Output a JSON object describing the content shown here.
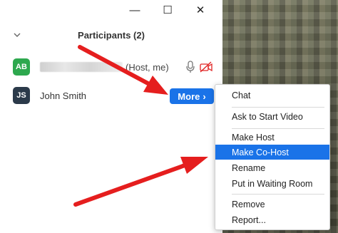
{
  "window": {
    "min_glyph": "—",
    "max_glyph": "☐",
    "close_glyph": "✕"
  },
  "panel": {
    "title": "Participants (2)"
  },
  "participants": [
    {
      "initials": "AB",
      "name": "",
      "role": "(Host, me)",
      "avatar_color": "#2da84e"
    },
    {
      "initials": "JS",
      "name": "John Smith",
      "avatar_color": "#2b3a4a"
    }
  ],
  "more_button": {
    "label": "More",
    "chevron": "›"
  },
  "menu": {
    "items": [
      {
        "label": "Chat"
      },
      {
        "label": "Ask to Start Video"
      },
      {
        "label": "Make Host"
      },
      {
        "label": "Make Co-Host",
        "highlighted": true
      },
      {
        "label": "Rename"
      },
      {
        "label": "Put in Waiting Room"
      },
      {
        "label": "Remove"
      },
      {
        "label": "Report..."
      }
    ]
  },
  "colors": {
    "accent": "#1a73e8",
    "arrow": "#e51e1e"
  }
}
